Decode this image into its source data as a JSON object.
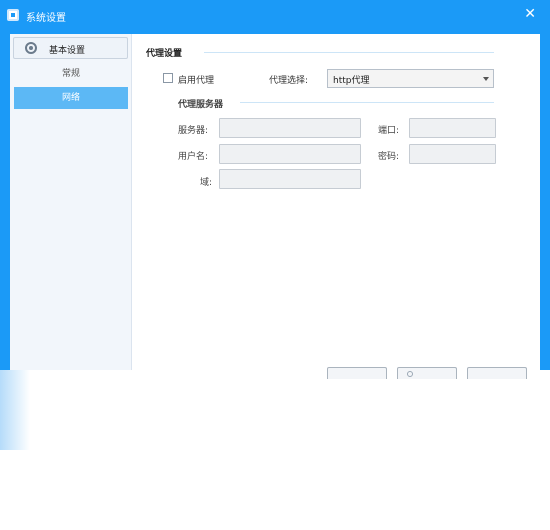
{
  "window": {
    "title": "系统设置",
    "close_glyph": "✕",
    "accent_color": "#1b9af7"
  },
  "sidebar": {
    "header_label": "基本设置",
    "header_icon": "gear-icon",
    "items": [
      {
        "label": "常规",
        "selected": false
      },
      {
        "label": "网络",
        "selected": true
      }
    ],
    "selected_color": "#5cb8f5"
  },
  "proxy": {
    "section_title": "代理设置",
    "use_proxy_label": "启用代理",
    "use_proxy_checked": false,
    "proxy_type_label": "代理选择:",
    "proxy_type_value": "http代理",
    "server_section_title": "代理服务器",
    "server_label": "服务器:",
    "server_value": "",
    "port_label": "端口:",
    "port_value": "",
    "username_label": "用户名:",
    "username_value": "",
    "password_label": "密码:",
    "password_value": "",
    "domain_label": "域:",
    "domain_value": ""
  }
}
